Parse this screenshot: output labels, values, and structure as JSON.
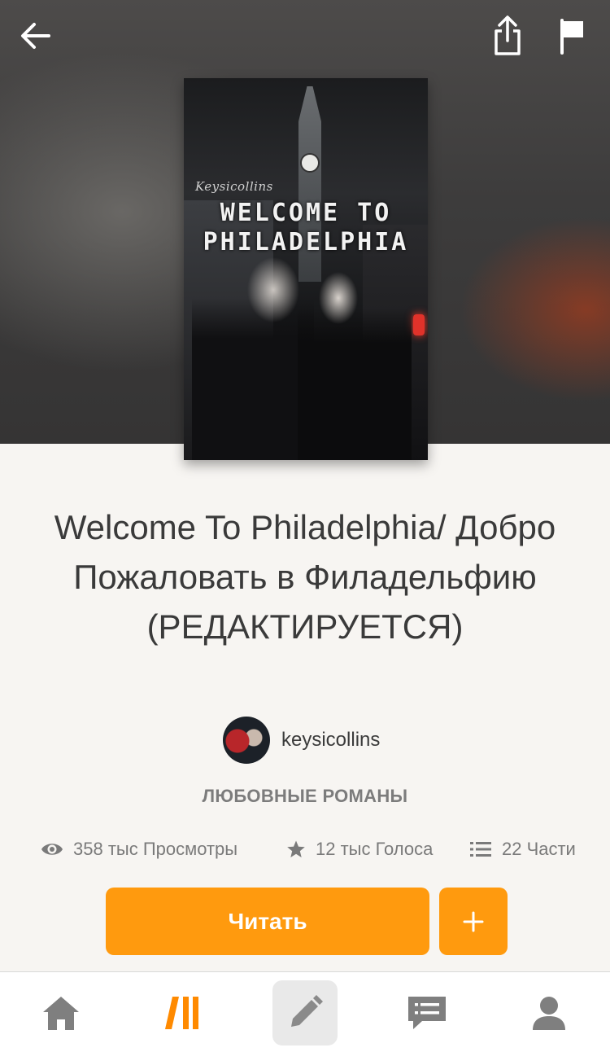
{
  "header": {
    "back_icon": "arrow-left-icon",
    "share_icon": "share-icon",
    "report_icon": "flag-icon"
  },
  "cover": {
    "credit": "Keysicollins",
    "title_line1": "WELCOME TO",
    "title_line2": "PHILADELPHIA"
  },
  "story": {
    "title": "Welcome To Philadelphia/ Добро Пожаловать в Филадельфию (РЕДАКТИРУЕТСЯ)",
    "author": "keysicollins",
    "genre": "ЛЮБОВНЫЕ РОМАНЫ"
  },
  "stats": {
    "views": "358 тыс Просмотры",
    "votes": "12 тыс Голоса",
    "parts": "22 Части"
  },
  "actions": {
    "read_label": "Читать",
    "add_label": "+"
  },
  "tabbar": {
    "items": [
      "home-icon",
      "browse-icon",
      "write-icon",
      "messages-icon",
      "profile-icon"
    ]
  },
  "colors": {
    "accent": "#ff9a0e",
    "background": "#f7f5f2",
    "inactive_icon": "#7f7f7f"
  }
}
